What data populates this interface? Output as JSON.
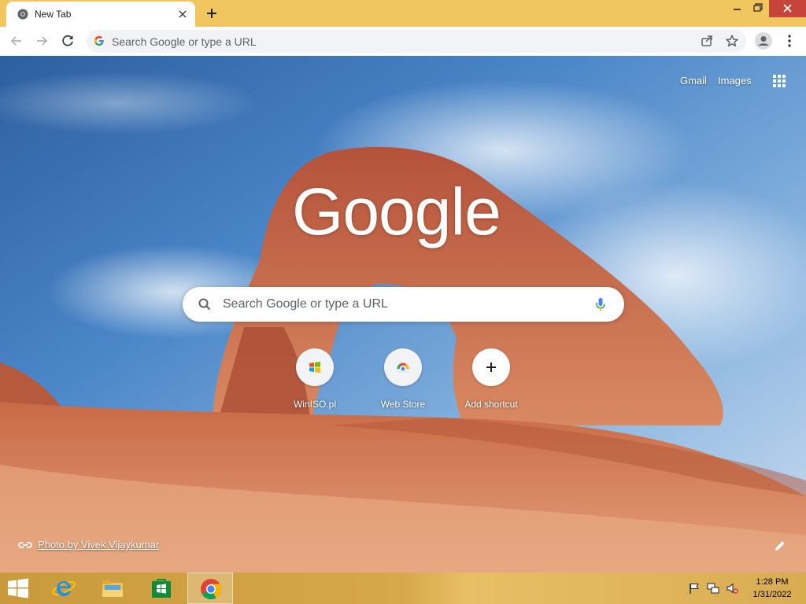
{
  "browser": {
    "tab": {
      "title": "New Tab",
      "favicon": "chrome-icon"
    },
    "omnibox": {
      "placeholder": "Search Google or type a URL"
    }
  },
  "ntp": {
    "links": {
      "gmail": "Gmail",
      "images": "Images"
    },
    "logo": "Google",
    "search": {
      "placeholder": "Search Google or type a URL"
    },
    "shortcuts": [
      {
        "label": "WinISO.pl",
        "icon": "windows-logo-icon"
      },
      {
        "label": "Web Store",
        "icon": "web-store-icon"
      },
      {
        "label": "Add shortcut",
        "icon": "plus-icon"
      }
    ],
    "attribution": "Photo by Vivek Vijaykumar"
  },
  "taskbar": {
    "apps": [
      {
        "name": "Internet Explorer",
        "icon": "internet-explorer-icon"
      },
      {
        "name": "File Explorer",
        "icon": "file-explorer-icon"
      },
      {
        "name": "Store",
        "icon": "store-icon"
      },
      {
        "name": "Google Chrome",
        "icon": "chrome-icon",
        "active": true
      }
    ],
    "clock": {
      "time": "1:28 PM",
      "date": "1/31/2022"
    }
  },
  "colors": {
    "titlebar": "#f2c65f",
    "close_button": "#c7443a",
    "omnibox_bg": "#f1f3f4",
    "text_muted": "#5f6368"
  }
}
